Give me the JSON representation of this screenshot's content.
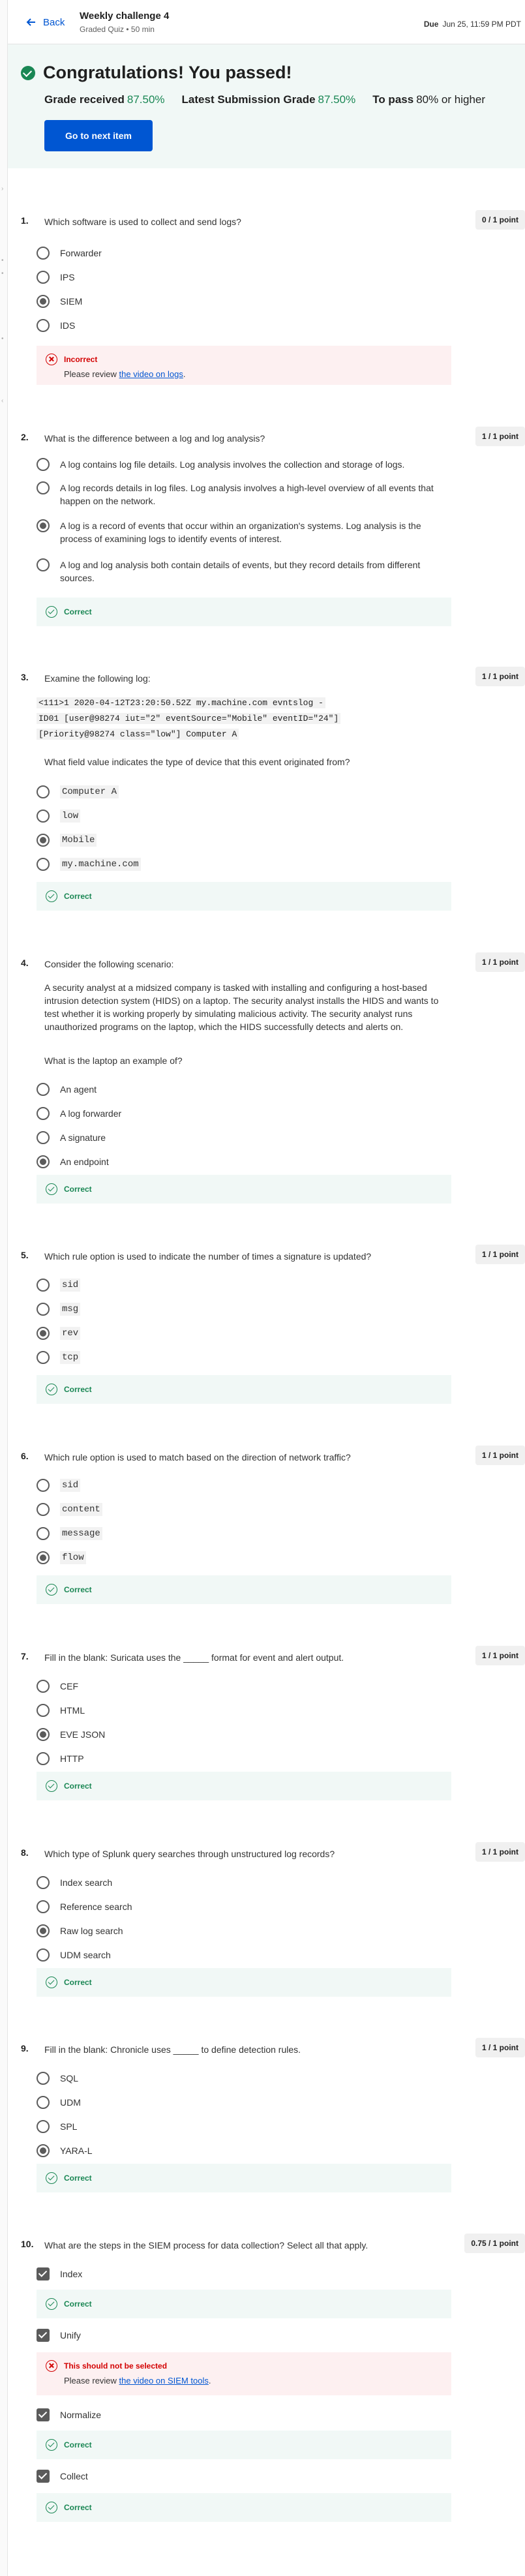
{
  "header": {
    "back_label": "Back",
    "quiz_title": "Weekly challenge 4",
    "quiz_subtitle": "Graded Quiz • 50 min",
    "due_label": "Due",
    "due_date": "Jun 25, 11:59 PM PDT"
  },
  "result": {
    "title": "Congratulations! You passed!",
    "grade_received_label": "Grade received",
    "grade_received": "87.50%",
    "latest_label": "Latest Submission Grade",
    "latest": "87.50%",
    "to_pass_label": "To pass",
    "to_pass": "80% or higher",
    "next_button": "Go to next item"
  },
  "questions": [
    {
      "num": "1.",
      "text": "Which software is used to collect and send logs?",
      "points": "0 / 1 point",
      "options": [
        "Forwarder",
        "IPS",
        "SIEM",
        "IDS"
      ],
      "selected": 2,
      "feedback": {
        "status": "Incorrect",
        "message": "Please review ",
        "link": "the video on logs",
        "suffix": "."
      }
    },
    {
      "num": "2.",
      "text": "What is the difference between a log and log analysis?",
      "points": "1 / 1 point",
      "options": [
        "A log contains log file details. Log analysis involves the collection and storage of logs.",
        "A log records details in log files. Log analysis involves a high-level overview of all events that happen on the network.",
        "A log is a record of events that occur within an organization's systems. Log analysis is the process of examining logs to identify events of interest.",
        "A log and log analysis both contain details of events, but they record details from different sources."
      ],
      "selected": 2,
      "feedback": {
        "status": "Correct"
      }
    },
    {
      "num": "3.",
      "text": "Examine the following log:",
      "log_lines": [
        "<111>1 2020-04-12T23:20:50.52Z my.machine.com evntslog -",
        "ID01 [user@98274 iut=\"2\" eventSource=\"Mobile\" eventID=\"24\"]",
        "[Priority@98274 class=\"low\"] Computer A"
      ],
      "subtext": "What field value indicates the type of device that this event originated from?",
      "points": "1 / 1 point",
      "options": [
        "Computer A",
        "low",
        "Mobile",
        "my.machine.com"
      ],
      "selected": 2,
      "feedback": {
        "status": "Correct"
      }
    },
    {
      "num": "4.",
      "text": "Consider the following scenario:",
      "scenario": "A security analyst at a midsized company is tasked with installing and configuring a host-based intrusion detection system (HIDS) on a laptop. The security analyst installs the HIDS and wants to test whether it is working properly by simulating malicious activity. The security analyst runs unauthorized programs on the laptop, which the HIDS successfully detects and alerts on.",
      "subtext": "What is the laptop an example of?",
      "points": "1 / 1 point",
      "options": [
        "An agent",
        "A log forwarder",
        "A signature",
        "An endpoint"
      ],
      "selected": 3,
      "feedback": {
        "status": "Correct"
      }
    },
    {
      "num": "5.",
      "text": "Which rule option is used to indicate the number of times a signature is updated?",
      "points": "1 / 1 point",
      "options": [
        "sid",
        "msg",
        "rev",
        "tcp"
      ],
      "selected": 2,
      "feedback": {
        "status": "Correct"
      }
    },
    {
      "num": "6.",
      "text": "Which rule option is used to match based on the direction of network traffic?",
      "points": "1 / 1 point",
      "options": [
        "sid",
        "content",
        "message",
        "flow"
      ],
      "selected": 3,
      "feedback": {
        "status": "Correct"
      }
    },
    {
      "num": "7.",
      "text": "Fill in the blank: Suricata uses the _____ format for event and alert output.",
      "points": "1 / 1 point",
      "options": [
        "CEF",
        "HTML",
        "EVE JSON",
        "HTTP"
      ],
      "selected": 2,
      "feedback": {
        "status": "Correct"
      }
    },
    {
      "num": "8.",
      "text": "Which type of Splunk query searches through unstructured log records?",
      "points": "1 / 1 point",
      "options": [
        "Index search",
        "Reference search",
        "Raw log search",
        "UDM search"
      ],
      "selected": 2,
      "feedback": {
        "status": "Correct"
      }
    },
    {
      "num": "9.",
      "text": "Fill in the blank: Chronicle uses _____ to define detection rules.",
      "points": "1 / 1 point",
      "options": [
        "SQL",
        "UDM",
        "SPL",
        "YARA-L"
      ],
      "selected": 3,
      "feedback": {
        "status": "Correct"
      }
    },
    {
      "num": "10.",
      "text": "What are the steps in the SIEM process for data collection? Select all that apply.",
      "points": "0.75 / 1 point",
      "options": [
        "Index",
        "Unify",
        "Normalize",
        "Collect"
      ],
      "feedback_list": [
        {
          "status": "Correct"
        },
        {
          "status": "This should not be selected",
          "message": "Please review ",
          "link": "the video on SIEM tools",
          "suffix": "."
        },
        {
          "status": "Correct"
        },
        {
          "status": "Correct"
        }
      ]
    }
  ]
}
